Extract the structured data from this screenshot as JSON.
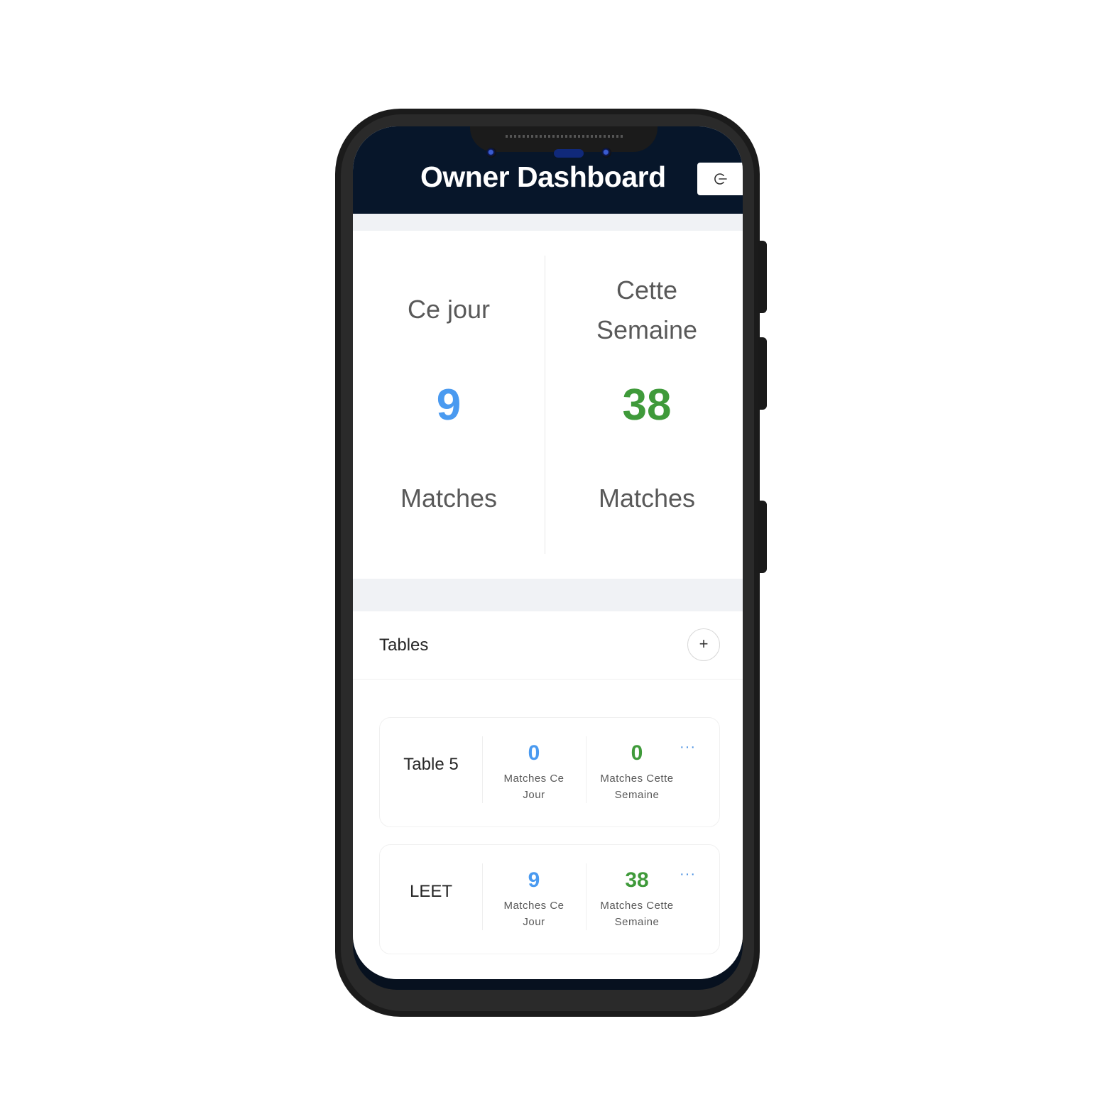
{
  "header": {
    "title": "Owner Dashboard",
    "logout_icon": "logout-icon"
  },
  "stats": {
    "today": {
      "title": "Ce jour",
      "value": "9",
      "unit": "Matches"
    },
    "week": {
      "title_line1": "Cette",
      "title_line2": "Semaine",
      "value": "38",
      "unit": "Matches"
    }
  },
  "tables": {
    "title": "Tables",
    "add_label": "+",
    "items": [
      {
        "name": "Table 5",
        "today_value": "0",
        "today_label_1": "Matches Ce",
        "today_label_2": "Jour",
        "week_value": "0",
        "week_label_1": "Matches Cette",
        "week_label_2": "Semaine",
        "more": "···"
      },
      {
        "name": "LEET",
        "today_value": "9",
        "today_label_1": "Matches Ce",
        "today_label_2": "Jour",
        "week_value": "38",
        "week_label_1": "Matches Cette",
        "week_label_2": "Semaine",
        "more": "···"
      }
    ]
  },
  "colors": {
    "header_bg": "#07162a",
    "today_accent": "#4a9af0",
    "week_accent": "#3f9a3a"
  }
}
